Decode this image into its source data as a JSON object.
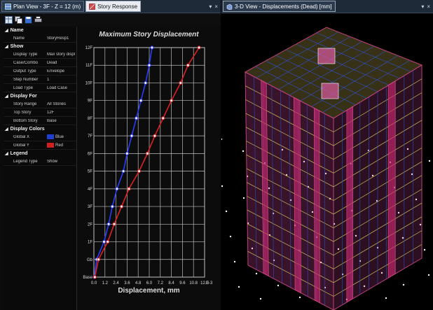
{
  "left_tabs": [
    {
      "label": "Plan View - 3F - Z = 12 (m)",
      "icon": "plan-view-icon"
    },
    {
      "label": "Story Response",
      "icon": "story-response-icon"
    }
  ],
  "right_tab": {
    "label": "3-D View  - Displacements (Dead)  [mm]",
    "icon": "3d-view-icon"
  },
  "window_controls": {
    "pin": "▾",
    "close": "×"
  },
  "toolbar_icons": [
    "table-icon",
    "copy-icon",
    "save-icon",
    "print-icon"
  ],
  "properties": {
    "sections": [
      {
        "title": "Name",
        "rows": [
          {
            "k": "Name",
            "v": "StoryResp1"
          }
        ]
      },
      {
        "title": "Show",
        "rows": [
          {
            "k": "Display Type",
            "v": "Max story displ"
          },
          {
            "k": "Case/Combo",
            "v": "Dead"
          },
          {
            "k": "Output Type",
            "v": "Envelope"
          },
          {
            "k": "Step Number",
            "v": "1"
          },
          {
            "k": "Load Type",
            "v": "Load Case"
          }
        ]
      },
      {
        "title": "Display For",
        "rows": [
          {
            "k": "Story Range",
            "v": "All Stories"
          },
          {
            "k": "Top Story",
            "v": "12F"
          },
          {
            "k": "Bottom Story",
            "v": "Base"
          }
        ]
      },
      {
        "title": "Display Colors",
        "rows": [
          {
            "k": "Global X",
            "v": "Blue",
            "color": "#1f3fd0"
          },
          {
            "k": "Global Y",
            "v": "Red",
            "color": "#d01f1f"
          }
        ]
      },
      {
        "title": "Legend",
        "rows": [
          {
            "k": "Legend Type",
            "v": "Show"
          }
        ]
      }
    ]
  },
  "chart_data": {
    "type": "line",
    "title": "Maximum Story Displacement",
    "xlabel": "Displacement, mm",
    "ylabel": "",
    "x_ticks": [
      "0.0",
      "1.2",
      "2.4",
      "3.6",
      "4.8",
      "6.0",
      "7.2",
      "8.4",
      "9.6",
      "10.8",
      "12.0"
    ],
    "x_exponent": "E-3",
    "xlim": [
      0,
      12.0
    ],
    "stories": [
      "Base",
      "Gb",
      "1F",
      "2F",
      "3F",
      "4F",
      "5F",
      "6F",
      "7F",
      "8F",
      "9F",
      "10F",
      "11F",
      "12F"
    ],
    "series": [
      {
        "name": "Global X",
        "color": "#2a3cff",
        "values": [
          0.05,
          0.3,
          1.1,
          1.6,
          2.0,
          2.5,
          3.2,
          3.6,
          4.1,
          4.6,
          5.1,
          5.6,
          6.0,
          6.3
        ]
      },
      {
        "name": "Global Y",
        "color": "#e02020",
        "values": [
          0.1,
          0.5,
          1.5,
          2.2,
          3.0,
          3.8,
          4.9,
          5.8,
          6.6,
          7.5,
          8.4,
          9.4,
          10.2,
          11.4
        ]
      }
    ]
  },
  "colors": {
    "panel_bg": "#0c0c0c",
    "grid": "#cfcfcf",
    "accent_blue": "#2a3cff",
    "accent_red": "#e02020",
    "mesh_pink": "#c0407a",
    "mesh_blue": "#3050d0",
    "mesh_yellow": "#d8d060"
  }
}
